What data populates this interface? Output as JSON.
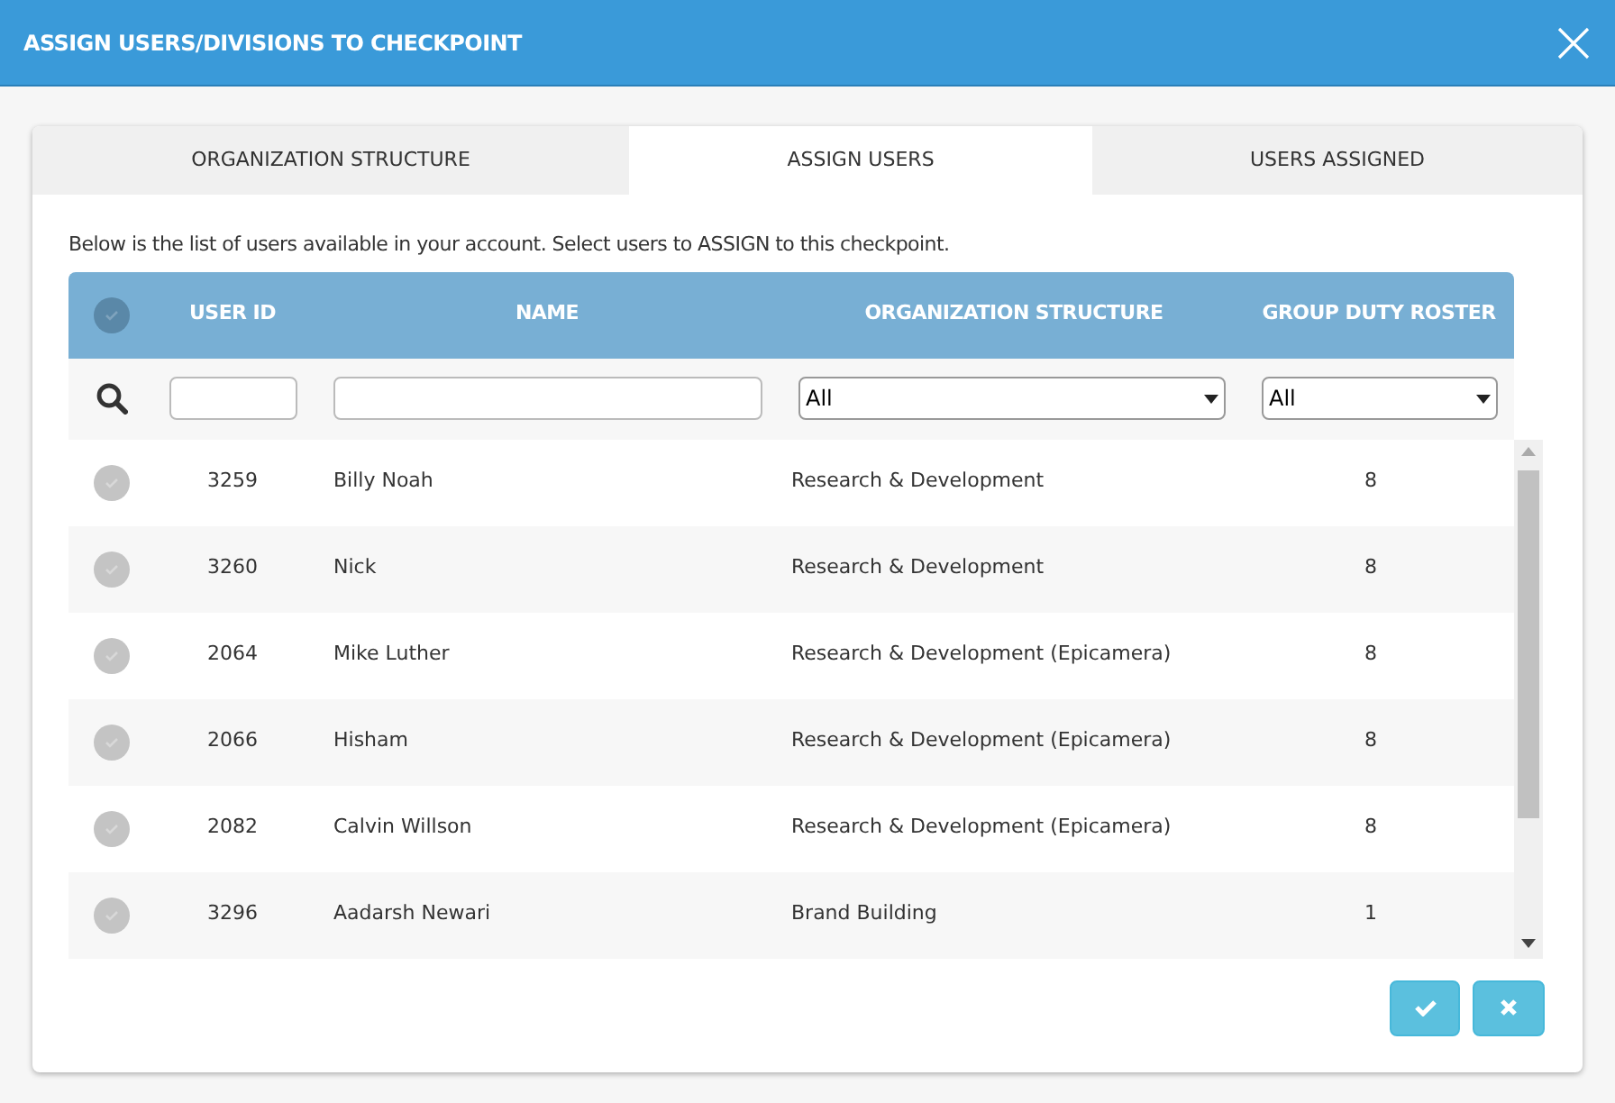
{
  "window": {
    "title": "ASSIGN USERS/DIVISIONS TO CHECKPOINT"
  },
  "tabs": [
    {
      "label": "ORGANIZATION STRUCTURE",
      "selected": false
    },
    {
      "label": "ASSIGN USERS",
      "selected": true
    },
    {
      "label": "USERS ASSIGNED",
      "selected": false
    }
  ],
  "intro": "Below is the list of users available in your account. Select users to ASSIGN to this checkpoint.",
  "table": {
    "select_all": {
      "checked": false
    },
    "columns": [
      "USER ID",
      "NAME",
      "ORGANIZATION STRUCTURE",
      "GROUP DUTY ROSTER"
    ],
    "filters": {
      "org_structure": "All",
      "group_duty_roster": "All"
    },
    "rows": [
      {
        "checked": false,
        "user_id": "3259",
        "name": "Billy Noah",
        "org": "Research & Development",
        "roster": "8"
      },
      {
        "checked": false,
        "user_id": "3260",
        "name": "Nick",
        "org": "Research & Development",
        "roster": "8"
      },
      {
        "checked": false,
        "user_id": "2064",
        "name": "Mike Luther",
        "org": "Research & Development (Epicamera)",
        "roster": "8"
      },
      {
        "checked": false,
        "user_id": "2066",
        "name": "Hisham",
        "org": "Research & Development (Epicamera)",
        "roster": "8"
      },
      {
        "checked": false,
        "user_id": "2082",
        "name": "Calvin Willson",
        "org": "Research & Development (Epicamera)",
        "roster": "8"
      },
      {
        "checked": false,
        "user_id": "3296",
        "name": "Aadarsh Newari",
        "org": "Brand Building",
        "roster": "1"
      }
    ]
  }
}
